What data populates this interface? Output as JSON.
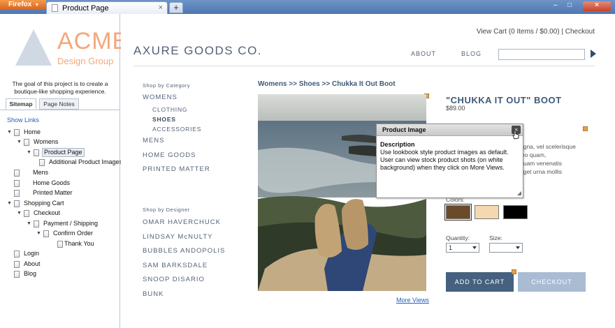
{
  "browser": {
    "menu_button": "Firefox",
    "tab_title": "Product Page",
    "tab_close": "×",
    "new_tab": "+",
    "minimize": "–",
    "maximize": "□",
    "close": "×"
  },
  "sitemap": {
    "logo_line1": "ACME",
    "logo_line2": "Design Group",
    "goal": "The goal of this project is to create a boutique-like shopping experience.",
    "tabs": [
      "Sitemap",
      "Page Notes"
    ],
    "show_links": "Show Links",
    "nodes": [
      {
        "label": "Home"
      },
      {
        "label": "Womens"
      },
      {
        "label": "Product Page"
      },
      {
        "label": "Additional Product Images"
      },
      {
        "label": "Mens"
      },
      {
        "label": "Home Goods"
      },
      {
        "label": "Printed Matter"
      },
      {
        "label": "Shopping Cart"
      },
      {
        "label": "Checkout"
      },
      {
        "label": "Payment / Shipping"
      },
      {
        "label": "Confirm Order"
      },
      {
        "label": "Thank You"
      },
      {
        "label": "Login"
      },
      {
        "label": "About"
      },
      {
        "label": "Blog"
      }
    ]
  },
  "header": {
    "view_cart": "View Cart (0 Items / $0.00) | Checkout",
    "brand": "AXURE GOODS CO.",
    "nav_about": "ABOUT",
    "nav_blog": "BLOG",
    "search_value": ""
  },
  "categories": {
    "heading": "Shop by Category",
    "womens": "WOMENS",
    "sub": [
      "CLOTHING",
      "SHOES",
      "ACCESSORIES"
    ],
    "mens": "MENS",
    "home_goods": "HOME GOODS",
    "printed_matter": "PRINTED MATTER"
  },
  "designers": {
    "heading": "Shop by Designer",
    "items": [
      "OMAR HAVERCHUCK",
      "LINDSAY McNULTY",
      "BUBBLES ANDOPOLIS",
      "SAM BARKSDALE",
      "SNOOP DISARIO",
      "BUNK"
    ]
  },
  "product": {
    "breadcrumb": "Womens >> Shoes >> Chukka It Out Boot",
    "title": "\"CHUKKA IT OUT\" BOOT",
    "price": "$89.00",
    "desc_lines": [
      "agna, vel scelerisque",
      "leo quam,",
      "quam venenatis",
      "eget urna mollis"
    ],
    "colors_label": "Colors:",
    "swatch_colors": [
      "#6b4a2a",
      "#f4d9b0",
      "#000000"
    ],
    "quantity_label": "Quantity:",
    "quantity_value": "1",
    "size_label": "Size:",
    "size_value": "",
    "add_to_cart": "ADD TO CART",
    "checkout": "CHECKOUT",
    "more_views": "More Views"
  },
  "popup": {
    "title": "Product Image",
    "close": "×",
    "desc_heading": "Description",
    "desc_text": "Use lookbook style product images as default. User can view stock product shots (on white background) when they click on More Views."
  }
}
